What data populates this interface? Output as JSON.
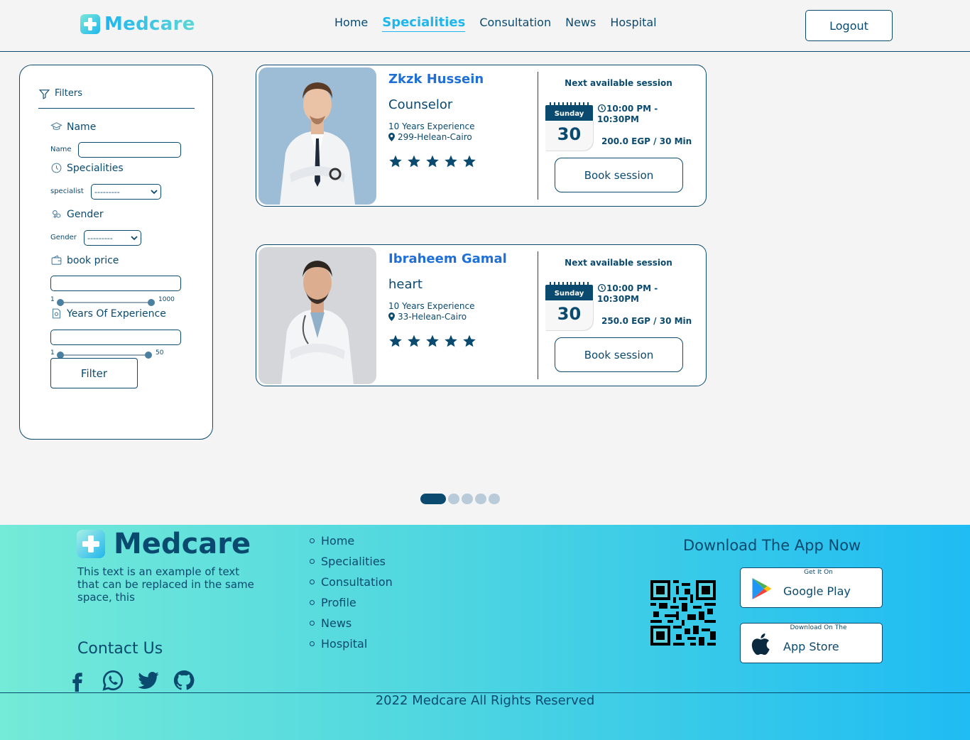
{
  "header": {
    "logo": "Medcare",
    "nav": [
      "Home",
      "Specialities",
      "Consultation",
      "News",
      "Hospital"
    ],
    "logout": "Logout"
  },
  "filters": {
    "title": "Filters",
    "name_section": "Name",
    "name_label": "Name",
    "specialities_section": "Specialities",
    "specialist_label": "specialist",
    "specialist_value": "---------",
    "gender_section": "Gender",
    "gender_label": "Gender",
    "gender_value": "---------",
    "price_section": "book price",
    "price_min": "1",
    "price_max": "1000",
    "experience_section": "Years Of Experience",
    "exp_min": "1",
    "exp_max": "50",
    "filter_button": "Filter"
  },
  "doctors": [
    {
      "name": "Zkzk Hussein",
      "speciality": "Counselor",
      "experience": "10 Years Experience",
      "location": "299-Helean-Cairo",
      "next_label": "Next available session",
      "day": "Sunday",
      "date": "30",
      "time": "10:00 PM -",
      "time2": "10:30PM",
      "price": "200.0 EGP / 30 Min",
      "book": "Book session",
      "rating": 5
    },
    {
      "name": "Ibraheem Gamal",
      "speciality": "heart",
      "experience": "10 Years Experience",
      "location": "33-Helean-Cairo",
      "next_label": "Next available session",
      "day": "Sunday",
      "date": "30",
      "time": "10:00 PM -",
      "time2": "10:30PM",
      "price": "250.0 EGP / 30 Min",
      "book": "Book session",
      "rating": 5
    }
  ],
  "pagination": {
    "pages": 5,
    "current": 1
  },
  "footer": {
    "logo": "Medcare",
    "description": "This text is an example of text that can be replaced in the same space, this",
    "contact": "Contact Us",
    "links": [
      "Home",
      "Specialities",
      "Consultation",
      "Profile",
      "News",
      "Hospital"
    ],
    "download_title": "Download The App Now",
    "google_small": "Get It On",
    "google_big": "Google Play",
    "apple_small": "Download On The",
    "apple_big": "App Store",
    "copyright": "2022 Medcare All Rights Reserved"
  },
  "colors": {
    "primary": "#0b4a6f",
    "accent": "#1fb6ee",
    "name": "#1f6fd6"
  }
}
